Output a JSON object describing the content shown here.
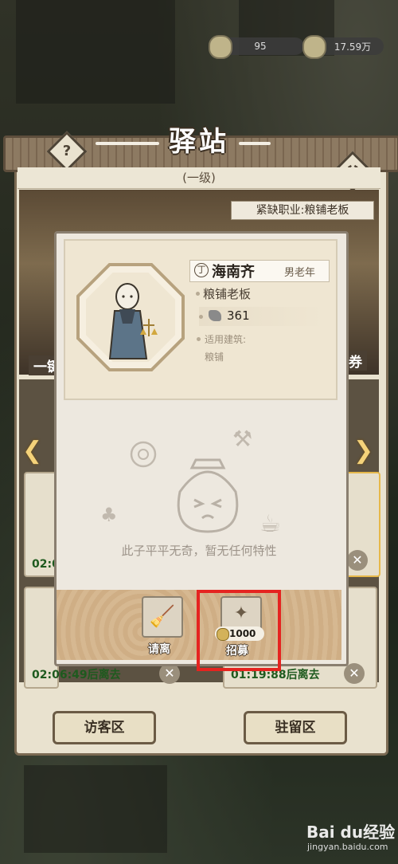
{
  "resources": {
    "energy": "95",
    "coins": "17.59万"
  },
  "header": {
    "title": "驿站",
    "level": "(一级)",
    "shortage": "紧缺职业:粮铺老板"
  },
  "side_tags": {
    "left": "一键",
    "right": "券"
  },
  "slots": [
    {
      "timer": "02:0",
      "label": ""
    },
    {
      "timer": "02:06:49后离去",
      "label": ""
    },
    {
      "timer": "01:19:88后离去",
      "label": ""
    }
  ],
  "bottom_buttons": {
    "visitors": "访客区",
    "stay": "驻留区"
  },
  "character": {
    "name": "海南齐",
    "tag": "男老年",
    "job": "粮铺老板",
    "power": "361",
    "building_label": "适用建筑:",
    "building": "粮铺",
    "trait_text": "此子平平无奇，暂无任何特性"
  },
  "actions": {
    "dismiss": "请离",
    "recruit": "招募",
    "recruit_cost": "1000"
  },
  "watermark": {
    "brand": "Bai du经验",
    "url": "jingyan.baidu.com"
  },
  "colors": {
    "highlight": "#e52420",
    "panel": "#ede8df",
    "timer": "#1e5a1e"
  }
}
